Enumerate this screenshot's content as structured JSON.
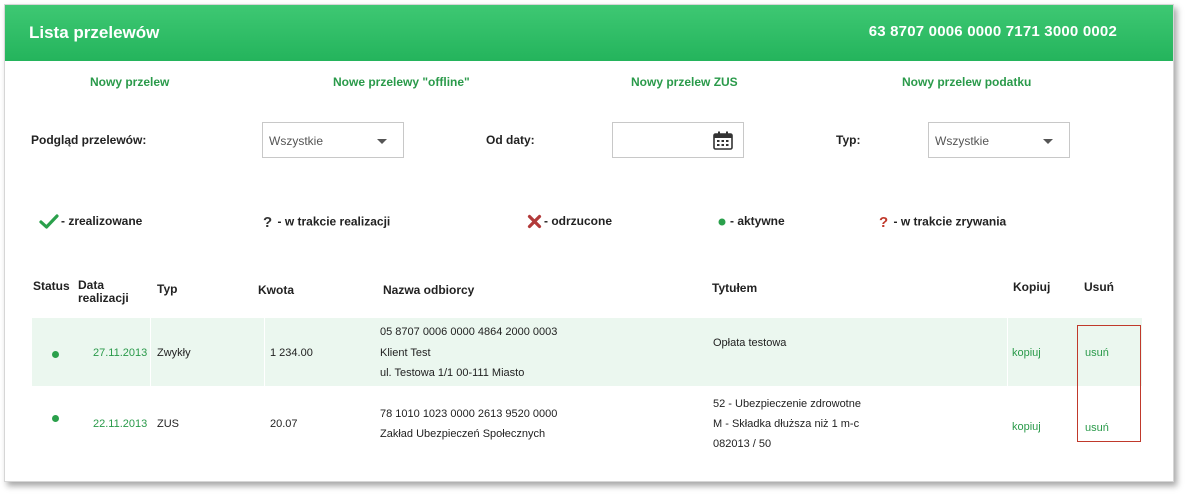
{
  "header": {
    "title": "Lista przelewów",
    "account_number": "63 8707 0006 0000 7171 3000 0002"
  },
  "actions": [
    {
      "label": "Nowy przelew"
    },
    {
      "label": "Nowe przelewy \"offline\""
    },
    {
      "label": "Nowy przelew ZUS"
    },
    {
      "label": "Nowy przelew podatku"
    }
  ],
  "filters": {
    "preview_label": "Podgląd przelewów:",
    "preview_value": "Wszystkie",
    "from_date_label": "Od daty:",
    "from_date_value": "",
    "type_label": "Typ:",
    "type_value": "Wszystkie"
  },
  "legend": [
    {
      "icon": "check-icon",
      "label": "- zrealizowane"
    },
    {
      "icon": "question-icon",
      "label": "- w trakcie realizacji"
    },
    {
      "icon": "cross-icon",
      "label": "- odrzucone"
    },
    {
      "icon": "dot-icon",
      "label": "- aktywne"
    },
    {
      "icon": "question-red-icon",
      "label": "- w trakcie zrywania"
    }
  ],
  "table": {
    "columns": {
      "status": "Status",
      "date_line1": "Data",
      "date_line2": "realizacji",
      "type": "Typ",
      "amount": "Kwota",
      "recipient": "Nazwa odbiorcy",
      "title": "Tytułem",
      "copy": "Kopiuj",
      "delete": "Usuń"
    },
    "rows": [
      {
        "status": "dot-icon",
        "date": "27.11.2013",
        "type": "Zwykły",
        "amount": "1 234.00",
        "recipient_lines": [
          "05 8707 0006 0000 4864 2000 0003",
          "Klient Test",
          "ul. Testowa 1/1 00-111 Miasto"
        ],
        "title_lines": [
          "Opłata testowa"
        ],
        "copy": "kopiuj",
        "delete": "usuń"
      },
      {
        "status": "dot-icon",
        "date": "22.11.2013",
        "type": "ZUS",
        "amount": "20.07",
        "recipient_lines": [
          "78 1010 1023 0000 2613 9520 0000",
          "Zakład Ubezpieczeń Społecznych"
        ],
        "title_lines": [
          "52 - Ubezpieczenie zdrowotne",
          "M - Składka dłuższa niż 1 m-c",
          "082013 / 50"
        ],
        "copy": "kopiuj",
        "delete": "usuń"
      }
    ]
  },
  "colors": {
    "header_green": "#2dbd65",
    "link_green": "#2a9a4a",
    "row_highlight": "#ebf7ef",
    "highlight_border": "#c0392b"
  }
}
